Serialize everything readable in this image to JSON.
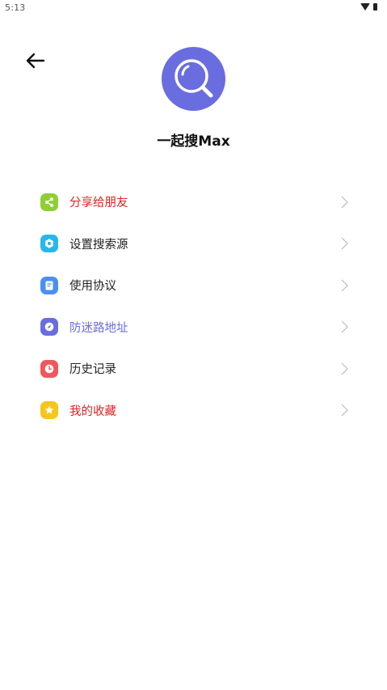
{
  "status": {
    "time": "5:13"
  },
  "app": {
    "name": "一起搜Max"
  },
  "menu": {
    "items": [
      {
        "label": "分享给朋友",
        "icon": "share-icon",
        "icon_color": "#8fcf34",
        "text_color": "#e02020"
      },
      {
        "label": "设置搜索源",
        "icon": "settings-icon",
        "icon_color": "#27b7ec",
        "text_color": "#222222"
      },
      {
        "label": "使用协议",
        "icon": "document-icon",
        "icon_color": "#4a90f0",
        "text_color": "#222222"
      },
      {
        "label": "防迷路地址",
        "icon": "compass-icon",
        "icon_color": "#6a6de0",
        "text_color": "#6a6de0"
      },
      {
        "label": "历史记录",
        "icon": "clock-icon",
        "icon_color": "#f0565a",
        "text_color": "#222222"
      },
      {
        "label": "我的收藏",
        "icon": "star-icon",
        "icon_color": "#f7c51a",
        "text_color": "#e02020"
      }
    ]
  },
  "colors": {
    "brand": "#6a6de0"
  }
}
